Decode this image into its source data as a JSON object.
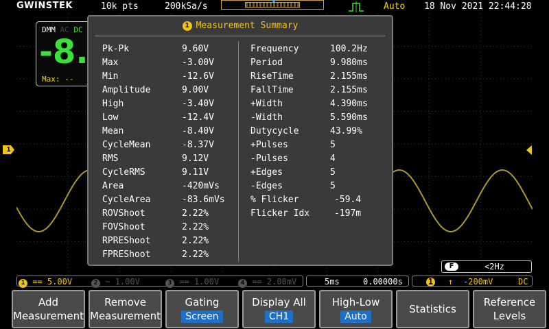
{
  "topbar": {
    "logo": "GWINSTEK",
    "record_length": "10k pts",
    "sample_rate": "200kSa/s",
    "acquire_mode": "Auto",
    "datetime": "18 Nov 2021 22:44:28"
  },
  "dmm": {
    "label": "DMM",
    "ac": "AC",
    "dc": "DC",
    "reading": "-8.",
    "max_label": "Max:",
    "max_value": "--"
  },
  "panel": {
    "title_num": "1",
    "title": "Measurement Summary",
    "left": [
      {
        "label": "Pk-Pk",
        "value": "9.60V"
      },
      {
        "label": "Max",
        "value": "-3.00V"
      },
      {
        "label": "Min",
        "value": "-12.6V"
      },
      {
        "label": "Amplitude",
        "value": "9.00V"
      },
      {
        "label": "High",
        "value": "-3.40V"
      },
      {
        "label": "Low",
        "value": "-12.4V"
      },
      {
        "label": "Mean",
        "value": "-8.40V"
      },
      {
        "label": "CycleMean",
        "value": "-8.37V"
      },
      {
        "label": "RMS",
        "value": "9.12V"
      },
      {
        "label": "CycleRMS",
        "value": "9.11V"
      },
      {
        "label": "Area",
        "value": "-420mVs"
      },
      {
        "label": "CycleArea",
        "value": "-83.6mVs"
      },
      {
        "label": "ROVShoot",
        "value": "2.22%"
      },
      {
        "label": "FOVShoot",
        "value": "2.22%"
      },
      {
        "label": "RPREShoot",
        "value": "2.22%"
      },
      {
        "label": "FPREShoot",
        "value": "2.22%"
      }
    ],
    "right": [
      {
        "label": "Frequency",
        "value": "100.2Hz"
      },
      {
        "label": "Period",
        "value": "9.980ms"
      },
      {
        "label": "RiseTime",
        "value": "2.155ms"
      },
      {
        "label": "FallTime",
        "value": "2.155ms"
      },
      {
        "label": "+Width",
        "value": "4.390ms"
      },
      {
        "label": "-Width",
        "value": "5.590ms"
      },
      {
        "label": "Dutycycle",
        "value": "43.99%"
      },
      {
        "label": "+Pulses",
        "value": "5"
      },
      {
        "label": "-Pulses",
        "value": "4"
      },
      {
        "label": "+Edges",
        "value": "5"
      },
      {
        "label": "-Edges",
        "value": "5"
      },
      {
        "label": "% Flicker",
        "value": "-59.4"
      },
      {
        "label": "Flicker Idx",
        "value": "-197m"
      }
    ]
  },
  "marker": {
    "channel": "1"
  },
  "filter": {
    "badge": "F",
    "value": "<2Hz"
  },
  "channels": [
    {
      "num": "1",
      "coupling": "==",
      "scale": "5.00V",
      "color": "#f0c419"
    },
    {
      "num": "2",
      "coupling": "~",
      "scale": "1.00V",
      "color": "#555555"
    },
    {
      "num": "3",
      "coupling": "==",
      "scale": "1.00V",
      "color": "#555555"
    },
    {
      "num": "4",
      "coupling": "==",
      "scale": "2.00mV",
      "color": "#555555"
    }
  ],
  "timebase": {
    "scale": "5ms",
    "position": "0.00000s"
  },
  "trigger": {
    "num": "1",
    "level": "-200mV",
    "coupling": "DC"
  },
  "softkeys": [
    {
      "line1": "Add",
      "line2": "Measurement"
    },
    {
      "line1": "Remove",
      "line2": "Measurement"
    },
    {
      "line1": "Gating",
      "highlight": "Screen"
    },
    {
      "line1": "Display All",
      "highlight": "CH1"
    },
    {
      "line1": "High-Low",
      "highlight": "Auto"
    },
    {
      "line1": "Statistics"
    },
    {
      "line1": "Reference",
      "line2": "Levels"
    }
  ],
  "colors": {
    "ch1": "#f0c419",
    "trace": "#a89a2c",
    "panel_bg": "#3a3a3a",
    "highlight": "#1e6fc8",
    "dmm_green": "#3ce03c"
  }
}
